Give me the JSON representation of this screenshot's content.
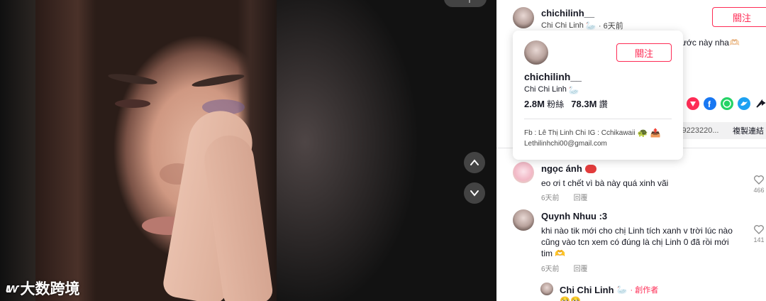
{
  "video": {
    "top_pill_label": "一个",
    "watermark_logo": "ɩⱳ",
    "watermark_text": "大数跨境"
  },
  "header": {
    "username": "chichilinh__",
    "nickname": "Chi Chi Linh",
    "nickname_emoji": "🦢",
    "time": "· 6天前",
    "follow_label": "關注",
    "description_tail": "ước này nha🫶🏻"
  },
  "share": {
    "icons": [
      "embed-icon",
      "facebook-icon",
      "whatsapp-icon",
      "twitter-icon",
      "more-share-icon"
    ],
    "link_value": "9223220...",
    "copy_label": "複製連結"
  },
  "popover": {
    "username": "chichilinh__",
    "nickname": "Chi Chi Linh",
    "nickname_emoji": "🦢",
    "follow_label": "關注",
    "followers_value": "2.8M",
    "followers_label": "粉絲",
    "likes_value": "78.3M",
    "likes_label": "讚",
    "bio_line1": "Fb : Lê Thị Linh Chi IG : Cchikawaii",
    "bio_line1_emojis": "🐢 📤",
    "bio_line2": "Lethilinhchi00@gmail.com"
  },
  "comments": [
    {
      "name": "ngọc ánh",
      "text": "eo ơi t chết vì bà này quá xinh vãi",
      "time": "6天前",
      "reply_label": "回覆",
      "likes": "466"
    },
    {
      "name": "Quynh Nhuu :3",
      "text": "khi nào tik mới cho chị Linh tích xanh v trời lúc nào cũng vào tcn xem có đúng là chị Linh 0 đã rồi mới tim 🫶",
      "time": "6天前",
      "reply_label": "回覆",
      "likes": "141"
    },
    {
      "name": "Chi Chi Linh",
      "name_emoji": "🦢",
      "creator_label": "· 創作者",
      "text": "🥺🥺"
    }
  ],
  "colors": {
    "accent": "#fe2c55",
    "text": "#161823",
    "muted": "#888888"
  }
}
